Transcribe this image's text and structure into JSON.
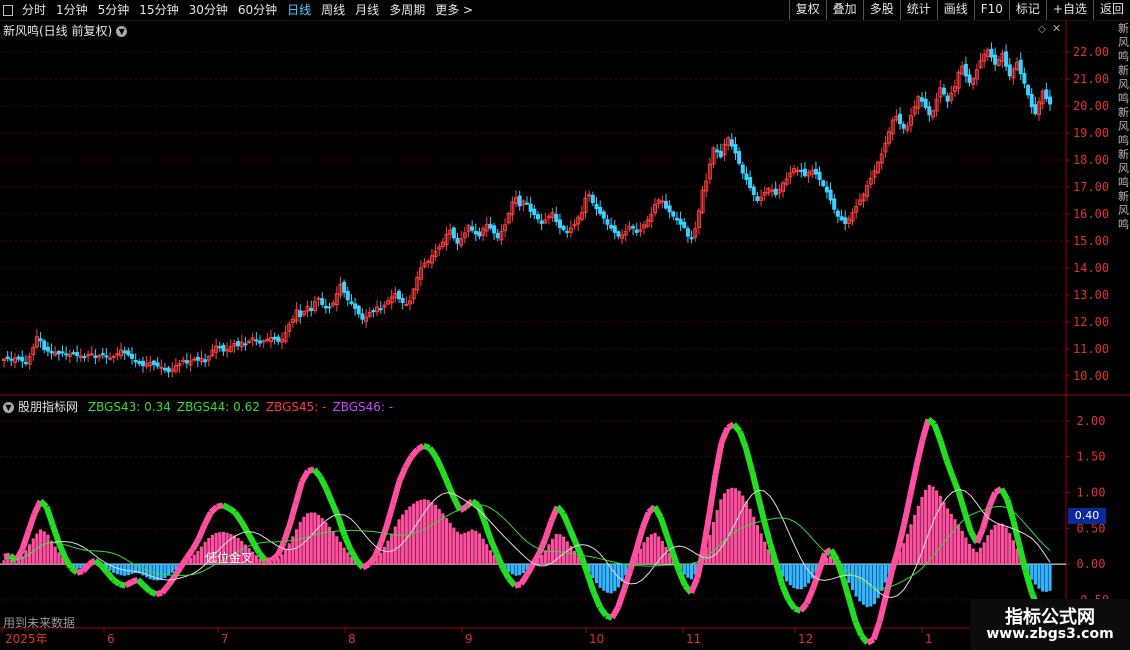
{
  "toolbar": {
    "periods": [
      "分时",
      "1分钟",
      "5分钟",
      "15分钟",
      "30分钟",
      "60分钟",
      "日线",
      "周线",
      "月线",
      "多周期",
      "更多 >"
    ],
    "active_period": "日线",
    "buttons": [
      "复权",
      "叠加",
      "多股",
      "统计",
      "画线",
      "F10",
      "标记",
      "+自选",
      "返回"
    ]
  },
  "main_panel": {
    "title": "新风鸣(日线 前复权)",
    "price_ticks": [
      "22.00",
      "21.00",
      "20.00",
      "19.00",
      "18.00",
      "17.00",
      "16.00",
      "15.00",
      "14.00",
      "13.00",
      "12.00",
      "11.00",
      "10.00"
    ],
    "side_text": "新风鸣新风鸣新风鸣新风鸣新风鸣"
  },
  "indicator_panel": {
    "title": "股朋指标网",
    "legend": [
      {
        "label": "ZBGS43: 0.34",
        "color": "#33dd33"
      },
      {
        "label": "ZBGS44: 0.62",
        "color": "#33dd33"
      },
      {
        "label": "ZBGS45: -",
        "color": "#ff3355"
      },
      {
        "label": "ZBGS46: -",
        "color": "#cc44ff"
      }
    ],
    "ticks": [
      "2.00",
      "1.50",
      "1.00",
      "0.50",
      "0.00",
      "-0.50"
    ],
    "current_value": "0.40",
    "annotation": "低位金叉",
    "footer_note": "用到未来数据"
  },
  "date_axis": [
    "2025年",
    "6",
    "7",
    "8",
    "9",
    "10",
    "11",
    "12",
    "1"
  ],
  "watermark": {
    "line1": "指标公式网",
    "line2": "www.zbgs3.com"
  },
  "colors": {
    "up": "#ff4040",
    "down": "#3ad0ff",
    "hist_pos": "#ff4fa0",
    "hist_neg": "#33b5ff",
    "osc": "#22dd22"
  },
  "chart_data": {
    "type": "candlestick",
    "close_series": [
      10.62,
      10.64,
      10.58,
      10.66,
      10.62,
      10.55,
      10.48,
      10.72,
      11.05,
      11.45,
      11.3,
      10.98,
      10.92,
      10.85,
      10.88,
      10.82,
      10.86,
      10.78,
      10.8,
      10.82,
      10.75,
      10.74,
      10.7,
      10.78,
      10.82,
      10.68,
      10.75,
      10.78,
      10.7,
      10.66,
      10.72,
      10.82,
      10.96,
      10.85,
      10.78,
      10.65,
      10.52,
      10.46,
      10.38,
      10.45,
      10.5,
      10.42,
      10.36,
      10.32,
      10.22,
      10.15,
      10.25,
      10.38,
      10.45,
      10.58,
      10.48,
      10.55,
      10.62,
      10.58,
      10.65,
      10.52,
      10.72,
      10.95,
      11.1,
      11.05,
      10.92,
      10.98,
      11.08,
      11.2,
      11.12,
      11.25,
      11.18,
      11.28,
      11.4,
      11.32,
      11.22,
      11.3,
      11.35,
      11.42,
      11.36,
      11.28,
      11.35,
      11.6,
      11.92,
      12.1,
      12.45,
      12.2,
      12.38,
      12.58,
      12.42,
      12.75,
      12.88,
      12.65,
      12.52,
      12.55,
      12.7,
      13.05,
      13.4,
      13.1,
      12.82,
      12.68,
      12.5,
      12.3,
      12.1,
      12.18,
      12.35,
      12.42,
      12.55,
      12.48,
      12.62,
      12.78,
      12.92,
      13.05,
      12.86,
      12.72,
      12.65,
      12.78,
      13.22,
      13.65,
      14.0,
      14.18,
      14.25,
      14.45,
      14.62,
      14.78,
      14.95,
      15.25,
      15.4,
      15.12,
      14.92,
      15.08,
      15.3,
      15.58,
      15.4,
      15.26,
      15.18,
      15.45,
      15.62,
      15.48,
      15.3,
      15.12,
      15.35,
      15.6,
      16.02,
      16.45,
      16.6,
      16.3,
      16.48,
      16.38,
      16.1,
      15.98,
      15.82,
      15.65,
      15.78,
      15.92,
      16.05,
      15.72,
      15.5,
      15.42,
      15.35,
      15.48,
      15.62,
      15.88,
      16.05,
      16.58,
      16.72,
      16.42,
      16.2,
      16.02,
      15.85,
      15.62,
      15.48,
      15.32,
      15.18,
      15.22,
      15.35,
      15.55,
      15.48,
      15.32,
      15.42,
      15.6,
      15.78,
      15.98,
      16.35,
      16.52,
      16.48,
      16.22,
      16.08,
      15.92,
      15.78,
      15.62,
      15.5,
      15.18,
      15.08,
      15.45,
      16.12,
      16.88,
      17.22,
      17.85,
      18.45,
      18.3,
      18.12,
      18.58,
      18.82,
      18.52,
      18.26,
      17.88,
      17.52,
      17.28,
      16.98,
      16.72,
      16.5,
      16.62,
      16.8,
      16.95,
      16.88,
      16.72,
      16.9,
      17.15,
      17.3,
      17.52,
      17.68,
      17.62,
      17.58,
      17.42,
      17.55,
      17.62,
      17.48,
      17.28,
      17.05,
      16.82,
      16.52,
      16.18,
      15.92,
      15.78,
      15.65,
      15.82,
      16.05,
      16.28,
      16.52,
      16.72,
      17.05,
      17.32,
      17.6,
      17.92,
      18.22,
      18.62,
      19.05,
      19.48,
      19.62,
      19.35,
      19.18,
      19.25,
      19.65,
      19.98,
      20.35,
      20.18,
      19.95,
      19.68,
      19.82,
      20.25,
      20.68,
      20.45,
      20.18,
      20.48,
      20.72,
      21.25,
      21.48,
      21.12,
      20.88,
      21.02,
      21.35,
      21.68,
      21.92,
      22.08,
      21.82,
      21.55,
      21.72,
      21.95,
      21.48,
      21.12,
      21.38,
      21.62,
      21.2,
      20.85,
      20.42,
      19.98,
      19.72,
      20.15,
      20.55,
      20.28,
      20.08
    ],
    "osc_series": [
      0.1,
      0.12,
      0.05,
      0.2,
      0.45,
      0.7,
      0.88,
      0.8,
      0.55,
      0.3,
      0.1,
      -0.05,
      -0.12,
      -0.1,
      0.0,
      0.05,
      -0.02,
      -0.12,
      -0.22,
      -0.28,
      -0.3,
      -0.25,
      -0.22,
      -0.3,
      -0.38,
      -0.42,
      -0.4,
      -0.3,
      -0.18,
      -0.05,
      0.08,
      0.2,
      0.35,
      0.55,
      0.72,
      0.8,
      0.82,
      0.78,
      0.72,
      0.6,
      0.45,
      0.3,
      0.15,
      0.05,
      0.05,
      0.12,
      0.3,
      0.55,
      0.85,
      1.15,
      1.3,
      1.32,
      1.22,
      1.05,
      0.85,
      0.65,
      0.4,
      0.2,
      0.05,
      -0.05,
      0.0,
      0.1,
      0.3,
      0.55,
      0.85,
      1.15,
      1.35,
      1.5,
      1.6,
      1.65,
      1.62,
      1.5,
      1.32,
      1.12,
      0.92,
      0.75,
      0.8,
      0.88,
      0.82,
      0.6,
      0.35,
      0.15,
      -0.05,
      -0.2,
      -0.3,
      -0.28,
      -0.15,
      0.0,
      0.15,
      0.35,
      0.6,
      0.8,
      0.7,
      0.5,
      0.3,
      0.1,
      -0.15,
      -0.4,
      -0.6,
      -0.72,
      -0.75,
      -0.6,
      -0.35,
      -0.08,
      0.2,
      0.5,
      0.72,
      0.8,
      0.65,
      0.4,
      0.15,
      -0.1,
      -0.3,
      -0.4,
      -0.2,
      0.2,
      0.7,
      1.25,
      1.7,
      1.9,
      1.95,
      1.85,
      1.62,
      1.3,
      0.95,
      0.6,
      0.28,
      0.0,
      -0.3,
      -0.5,
      -0.62,
      -0.65,
      -0.55,
      -0.35,
      -0.1,
      0.15,
      0.2,
      0.05,
      -0.2,
      -0.5,
      -0.8,
      -1.0,
      -1.1,
      -1.05,
      -0.8,
      -0.45,
      -0.1,
      0.2,
      0.55,
      0.95,
      1.35,
      1.72,
      2.02,
      1.95,
      1.72,
      1.45,
      1.22,
      1.0,
      0.72,
      0.45,
      0.3,
      0.5,
      0.8,
      1.0,
      1.05,
      0.9,
      0.6,
      0.25,
      -0.1,
      -0.4,
      -0.6,
      -0.72,
      -0.68
    ]
  }
}
